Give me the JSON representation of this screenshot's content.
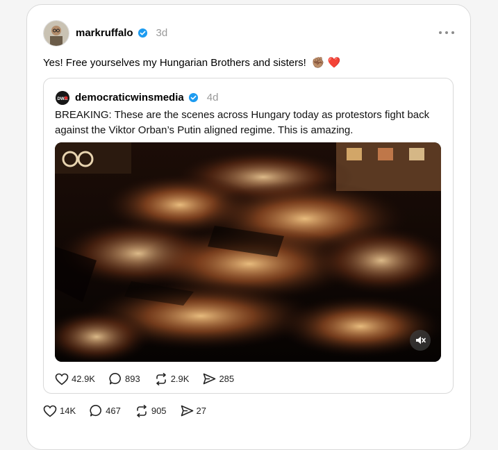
{
  "post": {
    "author": "markruffalo",
    "age": "3d",
    "text": "Yes! Free yourselves my Hungarian Brothers and sisters!",
    "emoji": "✊🏽 ❤️",
    "actions": {
      "likes": "14K",
      "comments": "467",
      "reposts": "905",
      "shares": "27"
    }
  },
  "quoted": {
    "author": "democraticwinsmedia",
    "avatar_text": "DWM",
    "age": "4d",
    "text": "BREAKING: These are the scenes across Hungary today as protestors fight back against the Viktor Orban’s Putin aligned regime. This is amazing.",
    "actions": {
      "likes": "42.9K",
      "comments": "893",
      "reposts": "2.9K",
      "shares": "285"
    }
  },
  "colors": {
    "verified": "#1d9bf0",
    "muted_text": "#999999",
    "border": "#d9d9d9"
  },
  "icons": [
    "verified-icon",
    "more-icon",
    "heart-icon",
    "comment-icon",
    "repost-icon",
    "share-icon",
    "mute-icon"
  ]
}
